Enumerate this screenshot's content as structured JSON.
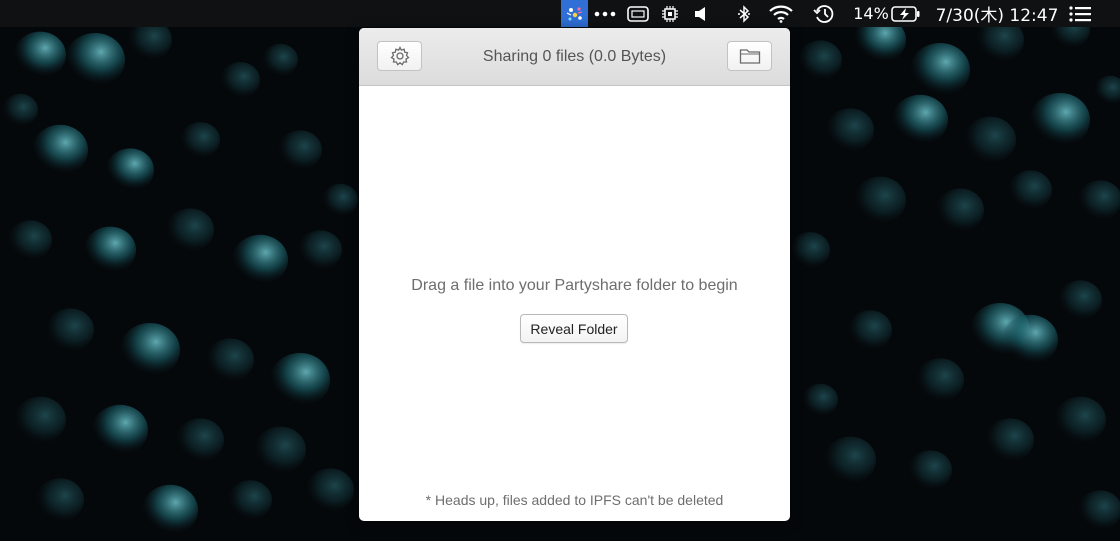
{
  "menubar": {
    "app_icon": "partyshare-confetti-icon",
    "more_icon": "ellipsis-icon",
    "items_icons": [
      "battery-menu-icon",
      "cpu-chip-icon",
      "volume-icon",
      "bluetooth-icon",
      "wifi-icon",
      "time-machine-icon",
      "battery-charging-icon",
      "list-menu-icon"
    ],
    "battery_percent": "14%",
    "datetime": "7/30(木) 12:47"
  },
  "popover": {
    "toolbar": {
      "title": "Sharing 0 files (0.0 Bytes)",
      "settings_icon": "gear-icon",
      "folder_icon": "folder-icon"
    },
    "empty_state": {
      "message": "Drag a file into your Partyshare folder to begin",
      "button_label": "Reveal Folder"
    },
    "footnote": "* Heads up, files added to IPFS can't be deleted"
  },
  "colors": {
    "menubar_bg": "#0f1113",
    "menubar_active": "#2f6fd6",
    "popover_bg": "#ffffff",
    "toolbar_bg": "#e4e4e4",
    "text_muted": "#6e6e6e",
    "wallpaper_bubble": "#2a8a95"
  }
}
